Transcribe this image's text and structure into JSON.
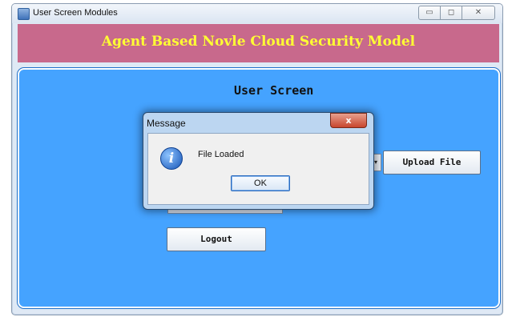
{
  "window": {
    "title": "User Screen Modules",
    "controls": {
      "minimize": "▭",
      "maximize": "◻",
      "close": "✕"
    }
  },
  "banner": {
    "text": "Agent Based Novle Cloud Security Model",
    "bg_color": "#c8698c",
    "text_color": "#ffff33"
  },
  "main": {
    "bg_color": "#45a3ff",
    "screen_title": "User Screen",
    "upload_button": "Upload File",
    "logout_button": "Logout",
    "combo_arrow": "▾"
  },
  "dialog": {
    "title": "Message",
    "close": "x",
    "icon": "info-icon",
    "icon_glyph": "i",
    "message": "File Loaded",
    "ok": "OK"
  }
}
